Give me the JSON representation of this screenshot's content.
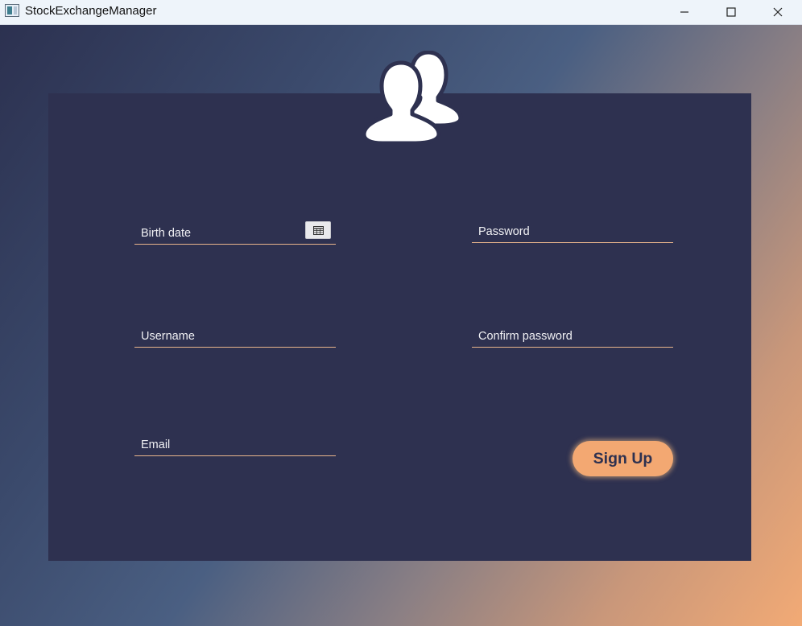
{
  "window": {
    "title": "StockExchangeManager"
  },
  "form": {
    "birth_date_label": "Birth date",
    "password_label": "Password",
    "username_label": "Username",
    "confirm_password_label": "Confirm password",
    "email_label": "Email",
    "signup_label": "Sign Up"
  },
  "icons": {
    "app": "app-window-icon",
    "minimize": "minimize-icon",
    "maximize": "maximize-icon",
    "close": "close-icon",
    "users": "users-icon",
    "calendar": "calendar-icon"
  },
  "colors": {
    "panel": "#2e3150",
    "accent": "#f3a872",
    "underline": "#e8b48c",
    "label": "#f1f1f4"
  }
}
